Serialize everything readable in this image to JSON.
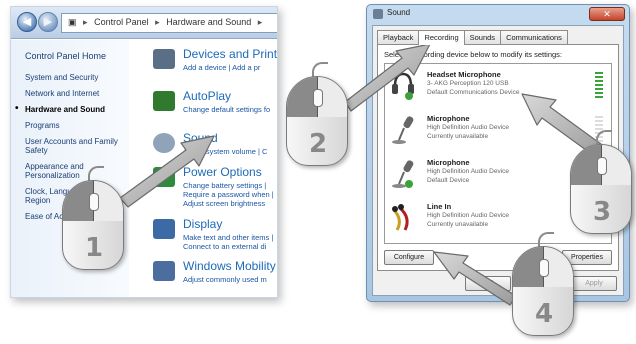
{
  "control_panel": {
    "breadcrumb": [
      "Control Panel",
      "Hardware and Sound"
    ],
    "sidebar": [
      {
        "label": "Control Panel Home"
      },
      {
        "label": "System and Security"
      },
      {
        "label": "Network and Internet"
      },
      {
        "label": "Hardware and Sound"
      },
      {
        "label": "Programs"
      },
      {
        "label": "User Accounts and Family Safety"
      },
      {
        "label": "Appearance and Personalization"
      },
      {
        "label": "Clock, Language, and Region"
      },
      {
        "label": "Ease of Access"
      }
    ],
    "categories": [
      {
        "title": "Devices and Printers",
        "sub": "Add a device | Add a pr",
        "icon": "printer-icon",
        "color": "#5a6e86"
      },
      {
        "title": "AutoPlay",
        "sub": "Change default settings fo",
        "icon": "autoplay-icon",
        "color": "#2f7a2f"
      },
      {
        "title": "Sound",
        "sub": "Adjust system volume | C",
        "icon": "speaker-icon",
        "color": "#8fa3b9"
      },
      {
        "title": "Power Options",
        "sub": "Change battery settings | Require a password when | Adjust screen brightness",
        "icon": "power-icon",
        "color": "#2e8b3e"
      },
      {
        "title": "Display",
        "sub": "Make text and other items | Connect to an external di",
        "icon": "display-icon",
        "color": "#3b6aa4"
      },
      {
        "title": "Windows Mobility C",
        "sub": "Adjust commonly used m",
        "icon": "mobility-icon",
        "color": "#4b6e9e"
      }
    ]
  },
  "sound_dialog": {
    "title": "Sound",
    "close_label": "✕",
    "tabs": [
      "Playback",
      "Recording",
      "Sounds",
      "Communications"
    ],
    "active_tab": "Recording",
    "instruction": "Select a recording device below to modify its settings:",
    "devices": [
      {
        "name": "Headset Microphone",
        "line1": "3- AKG Perception 120 USB",
        "line2": "Default Communications Device",
        "icon": "headset-icon",
        "active": true
      },
      {
        "name": "Microphone",
        "line1": "High Definition Audio Device",
        "line2": "Currently unavailable",
        "icon": "microphone-icon",
        "active": false
      },
      {
        "name": "Microphone",
        "line1": "High Definition Audio Device",
        "line2": "Default Device",
        "icon": "microphone-icon",
        "active": true
      },
      {
        "name": "Line In",
        "line1": "High Definition Audio Device",
        "line2": "Currently unavailable",
        "icon": "line-in-icon",
        "active": false
      }
    ],
    "buttons": {
      "configure": "Configure",
      "properties": "Properties",
      "ok": "OK",
      "apply": "Apply"
    }
  },
  "steps": [
    "1",
    "2",
    "3",
    "4"
  ]
}
